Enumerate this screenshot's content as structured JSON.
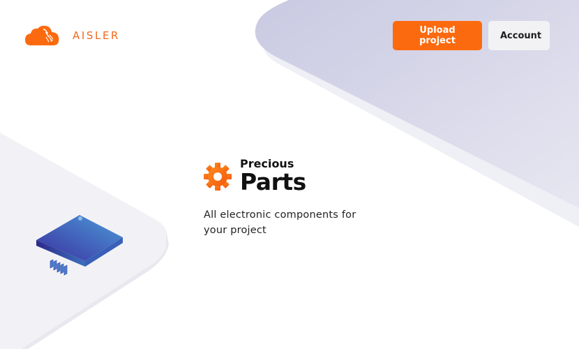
{
  "header": {
    "logo_text": "AISLER",
    "nav": {
      "upload_label": "Upload project",
      "account_label": "Account"
    }
  },
  "hero": {
    "title_top": "Precious",
    "title_main": "Parts",
    "description": "All electronic components for your project",
    "icon": "gear-icon"
  },
  "colors": {
    "accent": "#fc6a0f",
    "logo": "#f26a1b",
    "background_shape": "#d6d7e8",
    "secondary_button": "#f2f2f4",
    "chip_start": "#3d3aa6",
    "chip_end": "#4a97d6"
  }
}
